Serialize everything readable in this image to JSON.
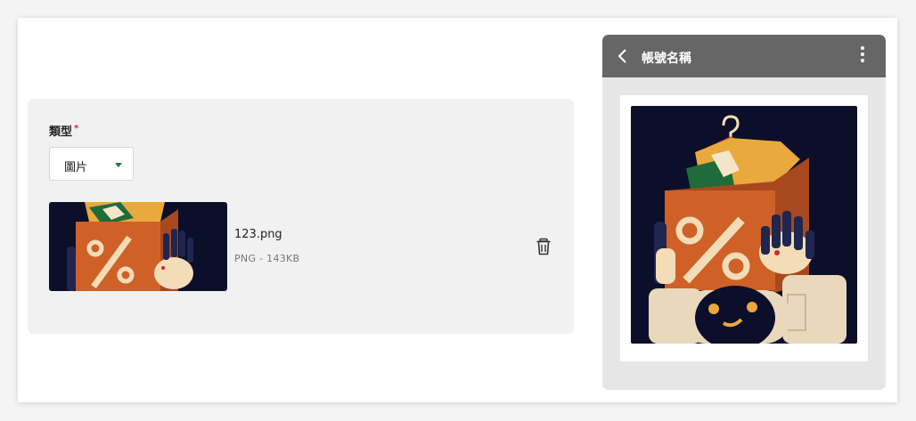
{
  "form": {
    "type_label": "類型",
    "required_mark": "*",
    "type_select": {
      "selected": "圖片"
    }
  },
  "file": {
    "name": "123.png",
    "meta": "PNG - 143KB"
  },
  "preview": {
    "account_name": "帳號名稱"
  },
  "icons": {
    "delete": "trash-icon",
    "back": "chevron-left-icon",
    "more": "kebab-menu-icon",
    "dropdown": "caret-down-icon"
  },
  "colors": {
    "panel_bg": "#f1f1f1",
    "header_bg": "#666666",
    "caret": "#1f7a32",
    "required": "#e0222a",
    "image_bg": "#0c0f2a",
    "box_orange": "#cf6128"
  }
}
